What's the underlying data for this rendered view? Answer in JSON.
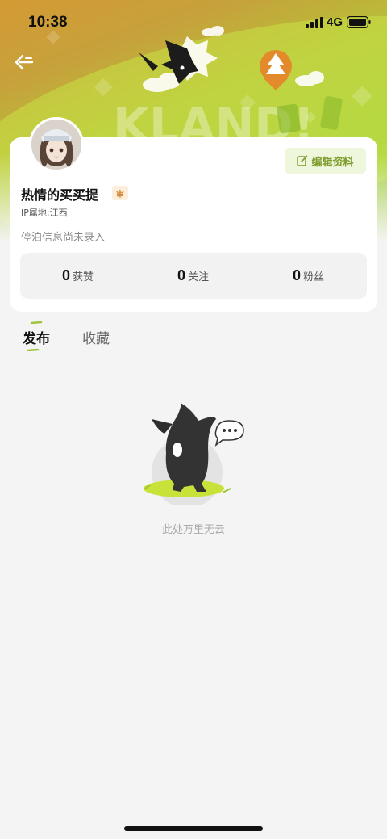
{
  "status_bar": {
    "time": "10:38",
    "network": "4G",
    "icons": [
      "signal-icon",
      "battery-icon"
    ]
  },
  "header": {
    "back_icon": "back-arrow-icon"
  },
  "profile": {
    "username": "热情的买买提",
    "badge": "审",
    "ip_location": "IP属地:江西",
    "bio": "停泊信息尚未录入",
    "edit_button_label": "编辑资料",
    "edit_icon": "edit-icon",
    "stats": [
      {
        "value": "0",
        "label": "获赞"
      },
      {
        "value": "0",
        "label": "关注"
      },
      {
        "value": "0",
        "label": "粉丝"
      }
    ]
  },
  "tabs": [
    {
      "label": "发布",
      "active": true
    },
    {
      "label": "收藏",
      "active": false
    }
  ],
  "empty_state": {
    "message": "此处万里无云",
    "illustration": "mascot-icon"
  },
  "colors": {
    "accent": "#9dc43a",
    "badge_text": "#d4832a",
    "edit_text": "#7e9b2b"
  }
}
